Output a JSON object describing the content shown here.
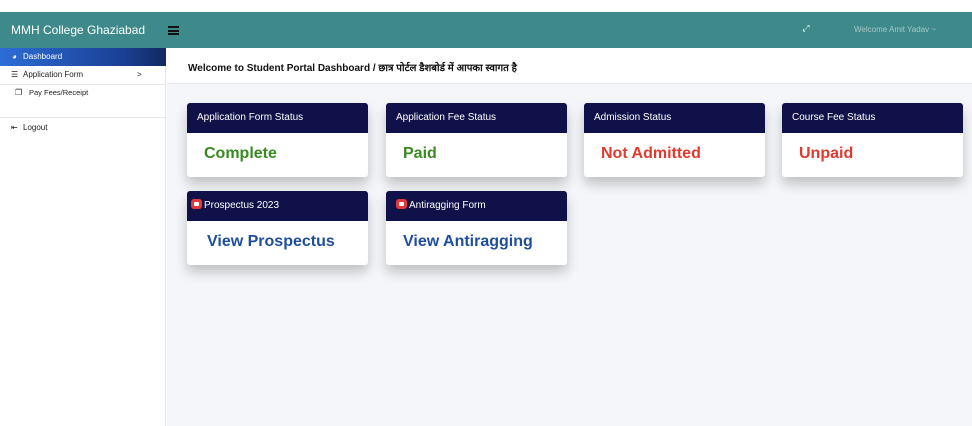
{
  "topbar": {
    "brand": "MMH College Ghaziabad",
    "welcome": "Welcome Amit Yadav ~",
    "menu_icon": "hamburger-icon",
    "expand_icon": "expand-icon"
  },
  "sidebar": {
    "items": [
      {
        "label": "Dashboard",
        "icon": "dashboard-icon",
        "active": true
      },
      {
        "label": "Application Form",
        "icon": "list-icon",
        "chevron": ">"
      },
      {
        "label": "Pay Fees/Receipt",
        "icon": "windows-icon"
      },
      {
        "label": "Logout",
        "icon": "logout-icon"
      }
    ]
  },
  "main": {
    "title": "Welcome to Student Portal Dashboard / छात्र पोर्टल डैशबोर्ड में आपका स्वागत है",
    "cards": [
      {
        "header": "Application Form Status",
        "value": "Complete",
        "color": "#3a8a22"
      },
      {
        "header": "Application Fee Status",
        "value": "Paid",
        "color": "#3a8a22"
      },
      {
        "header": "Admission Status",
        "value": "Not Admitted",
        "color": "#e03a2f"
      },
      {
        "header": "Course Fee Status",
        "value": "Unpaid",
        "color": "#e03a2f"
      },
      {
        "header": "Prospectus 2023",
        "value": "View Prospectus",
        "color": "#1f4f9a",
        "icon": "youtube-icon"
      },
      {
        "header": "Antiragging Form",
        "value": "View Antiragging",
        "color": "#1f4f9a",
        "icon": "youtube-icon"
      }
    ]
  },
  "colors": {
    "topbar": "#3e8a8a",
    "card_header": "#11114a",
    "active_nav": "#1a3f93",
    "success": "#3a8a22",
    "danger": "#e03a2f",
    "link": "#1f4f9a"
  }
}
